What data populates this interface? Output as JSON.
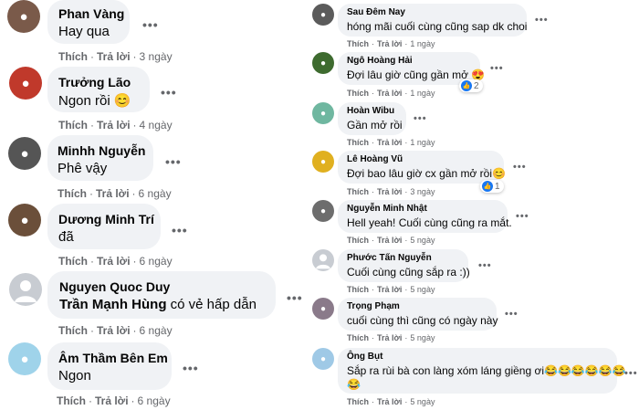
{
  "actions": {
    "like": "Thích",
    "reply": "Trả lời",
    "more": "•••"
  },
  "left_comments": [
    {
      "name": "Phan Vàng",
      "text": "Hay qua",
      "time": "3 ngày",
      "avatar_color": "#7a5a4a"
    },
    {
      "name": "Trưởng Lão",
      "text": "Ngon rồi 😊",
      "time": "4 ngày",
      "avatar_color": "#c0392b"
    },
    {
      "name": "Minhh Nguyễn",
      "text": "Phê vậy",
      "time": "6 ngày",
      "avatar_color": "#555555"
    },
    {
      "name": "Dương Minh Trí",
      "text": "đã",
      "time": "6 ngày",
      "avatar_color": "#6b4f3a"
    },
    {
      "name": "Nguyen Quoc Duy",
      "tag": "Trần Mạnh Hùng",
      "text": " có vẻ hấp dẫn",
      "time": "6 ngày",
      "avatar_color": "#c8ccd2"
    },
    {
      "name": "Âm Thầm Bên Em",
      "text": "Ngon",
      "time": "6 ngày",
      "avatar_color": "#9fd3ea"
    }
  ],
  "right_comments": [
    {
      "name": "Sau Đêm Nay",
      "text": "hóng mãi cuối cùng cũng sap dk choi",
      "time": "1 ngày",
      "avatar_color": "#5b5b5b"
    },
    {
      "name": "Ngô Hoàng Hải",
      "text": "Đợi lâu giờ cũng gần mở 😍",
      "time": "1 ngày",
      "reactions": "2",
      "avatar_color": "#3e6b2f"
    },
    {
      "name": "Hoàn Wibu",
      "text": "Gần mở rồi",
      "time": "1 ngày",
      "avatar_color": "#6fb7a0"
    },
    {
      "name": "Lê Hoàng Vũ",
      "text": "Đợi bao lâu giờ cx gần mở rồi😊",
      "time": "3 ngày",
      "reactions": "1",
      "avatar_color": "#e0b020"
    },
    {
      "name": "Nguyễn Minh Nhật",
      "text": "Hell yeah! Cuối cùng cũng ra mắt.",
      "time": "5 ngày",
      "avatar_color": "#6d6d6d"
    },
    {
      "name": "Phước Tấn Nguyễn",
      "text": "Cuối cùng cũng sắp ra :))",
      "time": "5 ngày",
      "avatar_color": "#c8ccd2"
    },
    {
      "name": "Trọng Phạm",
      "text": "cuối cùng thì cũng có ngày này",
      "time": "5 ngày",
      "avatar_color": "#8a7a8a"
    },
    {
      "name": "Ông Bụt",
      "text": "Sắp ra rùi bà con làng xóm láng giềng ơi😂😂😂😂😂😂",
      "text2": "😂",
      "time": "5 ngày",
      "avatar_color": "#9fc9e6"
    }
  ]
}
